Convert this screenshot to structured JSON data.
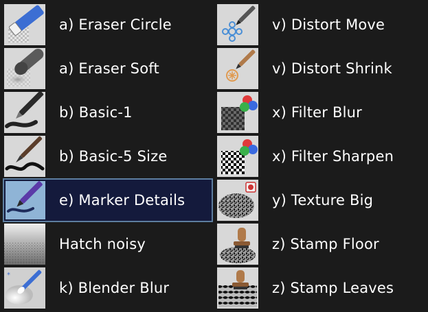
{
  "brush_list": {
    "left_column": [
      {
        "label": "a) Eraser Circle",
        "icon": "eraser-circle-icon"
      },
      {
        "label": "a) Eraser Soft",
        "icon": "eraser-soft-icon"
      },
      {
        "label": "b) Basic-1",
        "icon": "pen-basic-icon"
      },
      {
        "label": "b) Basic-5 Size",
        "icon": "pen-size-icon"
      },
      {
        "label": "e) Marker Details",
        "icon": "marker-icon",
        "selected": true
      },
      {
        "label": "Hatch noisy",
        "icon": "hatch-noise-icon"
      },
      {
        "label": "k) Blender Blur",
        "icon": "blender-icon"
      }
    ],
    "right_column": [
      {
        "label": "v) Distort Move",
        "icon": "distort-move-icon"
      },
      {
        "label": "v) Distort Shrink",
        "icon": "distort-shrink-icon"
      },
      {
        "label": "x) Filter Blur",
        "icon": "filter-blur-icon"
      },
      {
        "label": "x) Filter Sharpen",
        "icon": "filter-sharpen-icon"
      },
      {
        "label": "y) Texture Big",
        "icon": "texture-icon"
      },
      {
        "label": "z) Stamp Floor",
        "icon": "stamp-floor-icon"
      },
      {
        "label": "z) Stamp Leaves",
        "icon": "stamp-leaves-icon"
      }
    ]
  },
  "colors": {
    "background": "#1b1b1b",
    "selected_background": "#141a3c",
    "selected_border": "#5d7ea0",
    "text": "#ffffff"
  }
}
